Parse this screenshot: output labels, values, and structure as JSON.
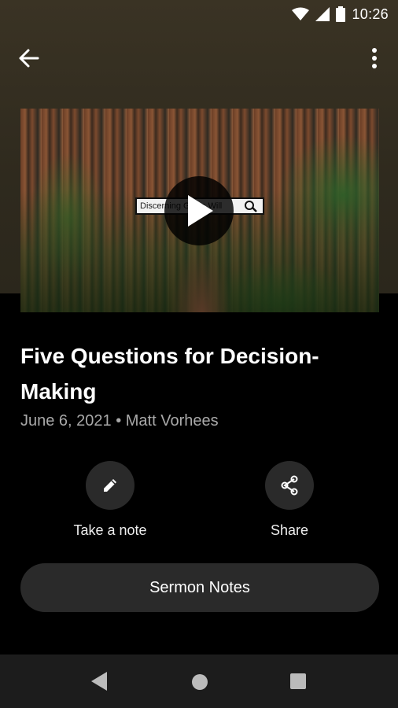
{
  "status_bar": {
    "time": "10:26"
  },
  "app_bar": {
    "back_icon": "arrow-left-icon",
    "menu_icon": "more-vert-icon"
  },
  "video": {
    "overlay_text": "Discerning God's Will",
    "play_icon": "play-icon"
  },
  "sermon": {
    "title": "Five Questions for Decision-Making",
    "meta": "June 6, 2021 • Matt Vorhees"
  },
  "actions": [
    {
      "label": "Take a note",
      "icon": "pencil-icon"
    },
    {
      "label": "Share",
      "icon": "share-icon"
    }
  ],
  "sermon_notes_label": "Sermon Notes",
  "colors": {
    "background": "#000000",
    "header": "#2f2a1e",
    "button": "#2a2a2a",
    "nav_bar": "#1c1c1c"
  }
}
